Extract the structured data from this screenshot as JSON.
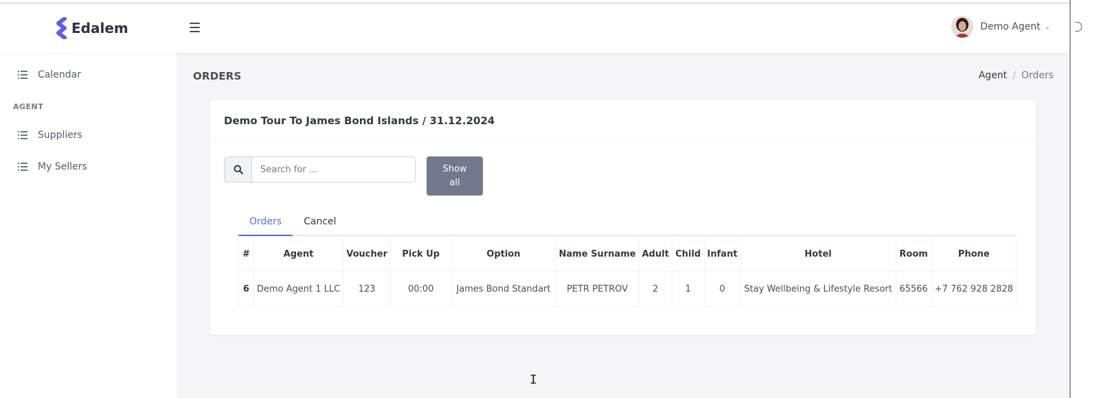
{
  "app": {
    "brand": "Edalem",
    "accent": "#556ee6"
  },
  "topbar": {
    "user_name": "Demo Agent"
  },
  "sidebar": {
    "section_title": "AGENT",
    "items": [
      {
        "label": "Calendar"
      },
      {
        "label": "Suppliers"
      },
      {
        "label": "My Sellers"
      }
    ]
  },
  "page": {
    "title": "ORDERS",
    "breadcrumb": [
      "Agent",
      "Orders"
    ]
  },
  "card": {
    "title": "Demo Tour To James Bond Islands / 31.12.2024",
    "search_placeholder": "Search for ...",
    "show_all_label": "Show all",
    "tabs": [
      {
        "label": "Orders",
        "active": true
      },
      {
        "label": "Cancel",
        "active": false
      }
    ]
  },
  "table": {
    "columns": [
      "#",
      "Agent",
      "Voucher",
      "Pick Up",
      "Option",
      "Name Surname",
      "Adult",
      "Child",
      "Infant",
      "Hotel",
      "Room",
      "Phone"
    ],
    "rows": [
      [
        "6",
        "Demo Agent 1 LLC",
        "123",
        "00:00",
        "James Bond Standart",
        "PETR PETROV",
        "2",
        "1",
        "0",
        "Stay Wellbeing & Lifestyle Resort",
        "65566",
        "+7 762 928 2828"
      ]
    ]
  }
}
